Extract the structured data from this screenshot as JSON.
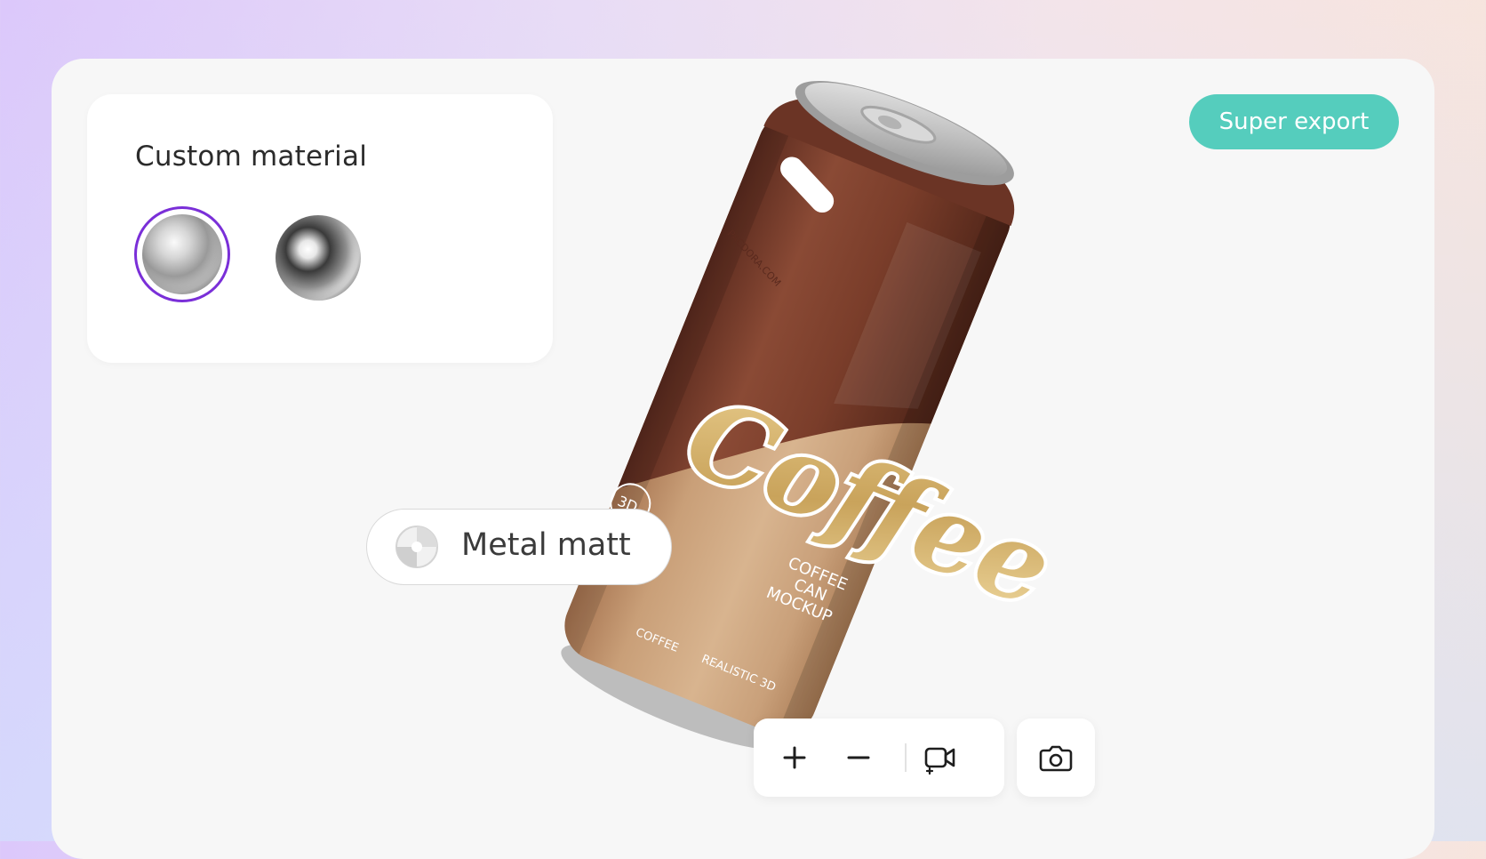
{
  "panel": {
    "title": "Custom material",
    "materials": [
      {
        "name": "matt-metal",
        "selected": true
      },
      {
        "name": "glossy-metal",
        "selected": false
      }
    ],
    "selection_color": "#7a2fd8"
  },
  "export": {
    "label": "Super export",
    "color": "#55cdbd"
  },
  "material_pill": {
    "label": "Metal matt",
    "icon": "half-sphere-icon"
  },
  "can": {
    "badge_text": "PACDORA.COM",
    "brand": "Coffee",
    "subtitle": [
      "COFFEE",
      "CAN",
      "MOCKUP"
    ],
    "circle_badge": "3D",
    "bottom_left_text": "COFFEE",
    "bottom_right_text": "REALISTIC 3D"
  },
  "controls": {
    "zoom_in": "plus-icon",
    "zoom_out": "minus-icon",
    "record": "video-record-icon",
    "screenshot": "camera-icon"
  }
}
